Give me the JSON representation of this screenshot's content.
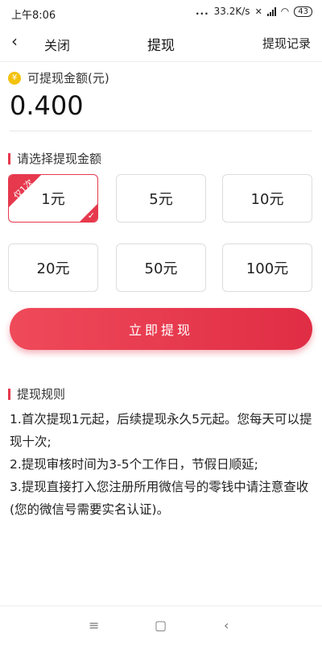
{
  "status_bar": {
    "time": "上午8:06",
    "dots": "...",
    "speed": "33.2K/s",
    "battery": "43"
  },
  "nav": {
    "back_icon": "‹",
    "close_label": "关闭",
    "title": "提现",
    "record_label": "提现记录"
  },
  "balance": {
    "coin_icon": "¥",
    "label": "可提现金额(元)",
    "amount": "0.400"
  },
  "choose_section": {
    "label": "请选择提现金额"
  },
  "options": [
    {
      "label": "1元",
      "badge": "仅1次",
      "selected": true
    },
    {
      "label": "5元"
    },
    {
      "label": "10元"
    },
    {
      "label": "20元"
    },
    {
      "label": "50元"
    },
    {
      "label": "100元"
    }
  ],
  "withdraw_button": "立即提现",
  "rules_section": {
    "label": "提现规则",
    "items": [
      "1.首次提现1元起，后续提现永久5元起。您每天可以提现十次;",
      "2.提现审核时间为3-5个工作日，节假日顺延;",
      "3.提现直接打入您注册所用微信号的零钱中请注意查收(您的微信号需要实名认证)。"
    ]
  },
  "system_bar": {
    "menu_icon": "≡",
    "home_icon": "▢",
    "back_icon": "‹"
  },
  "colors": {
    "accent": "#e6394d",
    "coin": "#f4c20d"
  }
}
